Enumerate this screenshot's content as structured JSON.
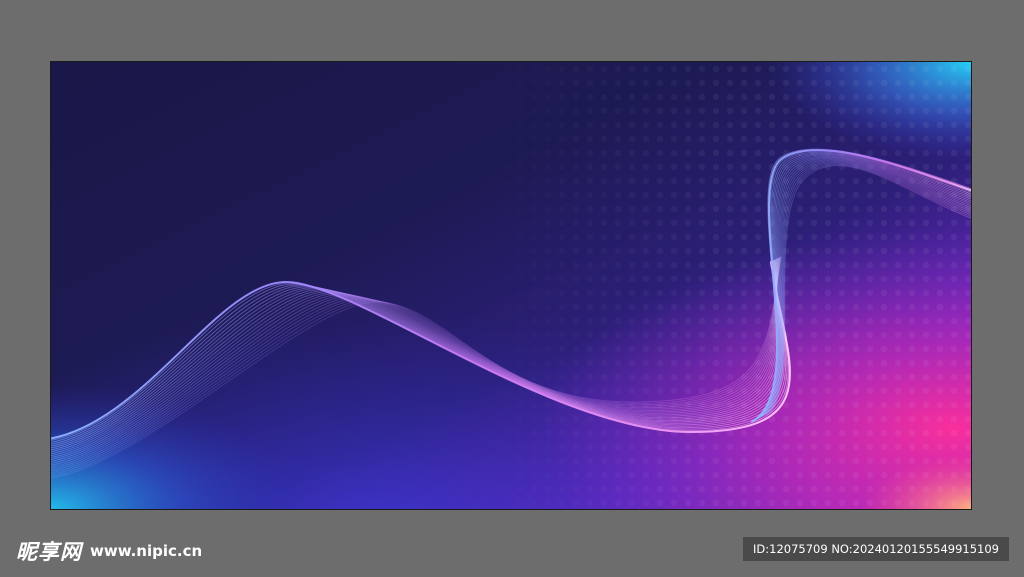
{
  "artwork": {
    "subject": "abstract-purple-blue-wave-background",
    "colors": {
      "dark_navy": "#1b1a4a",
      "deep_purple": "#3a1f7a",
      "violet": "#7a2fd0",
      "magenta": "#d02aa8",
      "cyan": "#23c7f0",
      "peach": "#ff9a70",
      "wave_light": "#f0a8ff"
    }
  },
  "watermark": {
    "site_name": "昵享网",
    "url": "www.nipic.cn"
  },
  "image_info": {
    "text": "ID:12075709 NO:20240120155549915109"
  }
}
